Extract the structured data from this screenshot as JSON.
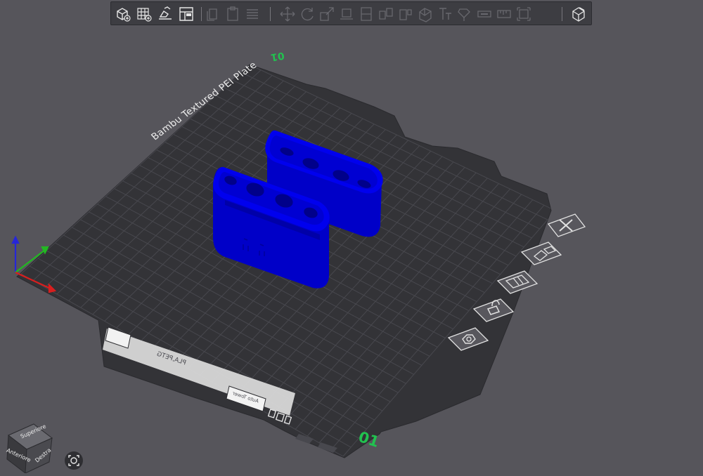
{
  "toolbar": {
    "items": [
      {
        "name": "add-object-icon",
        "enabled": true
      },
      {
        "name": "add-plate-icon",
        "enabled": true
      },
      {
        "name": "auto-orient-icon",
        "enabled": true
      },
      {
        "name": "arrange-icon",
        "enabled": true
      },
      {
        "name": "copy-icon",
        "enabled": false
      },
      {
        "name": "paste-icon",
        "enabled": false
      },
      {
        "name": "layers-icon",
        "enabled": false
      },
      {
        "name": "move-icon",
        "enabled": false
      },
      {
        "name": "rotate-icon",
        "enabled": false
      },
      {
        "name": "scale-icon",
        "enabled": false
      },
      {
        "name": "lay-on-face-icon",
        "enabled": false
      },
      {
        "name": "cut-icon",
        "enabled": false
      },
      {
        "name": "split-objects-icon",
        "enabled": false
      },
      {
        "name": "split-parts-icon",
        "enabled": false
      },
      {
        "name": "boolean-icon",
        "enabled": false
      },
      {
        "name": "text-icon",
        "enabled": false
      },
      {
        "name": "paint-support-icon",
        "enabled": false
      },
      {
        "name": "seam-icon",
        "enabled": false
      },
      {
        "name": "measure-icon",
        "enabled": false
      },
      {
        "name": "assembly-icon",
        "enabled": false
      },
      {
        "name": "variable-layer-icon",
        "enabled": true
      }
    ]
  },
  "plate": {
    "name": "Bambu Textured PEI Plate",
    "number": "01",
    "top_number": "01",
    "filament": "PLA,PETG",
    "sub_label": "Auto Tower"
  },
  "plate_tools": [
    {
      "name": "delete-plate-icon",
      "tip": "x"
    },
    {
      "name": "auto-arrange-plate-icon",
      "tip": "arrange"
    },
    {
      "name": "orient-plate-icon",
      "tip": "orient"
    },
    {
      "name": "lock-plate-icon",
      "tip": "lock"
    },
    {
      "name": "plate-settings-icon",
      "tip": "settings"
    }
  ],
  "view_cube": {
    "top": "Superiore",
    "front": "Anteriore",
    "right": "Destra"
  },
  "colors": {
    "background": "#56555b",
    "plate": "#333337",
    "grid": "#4a4a50",
    "model": "#0000e8",
    "accent_green": "#21c24f"
  }
}
